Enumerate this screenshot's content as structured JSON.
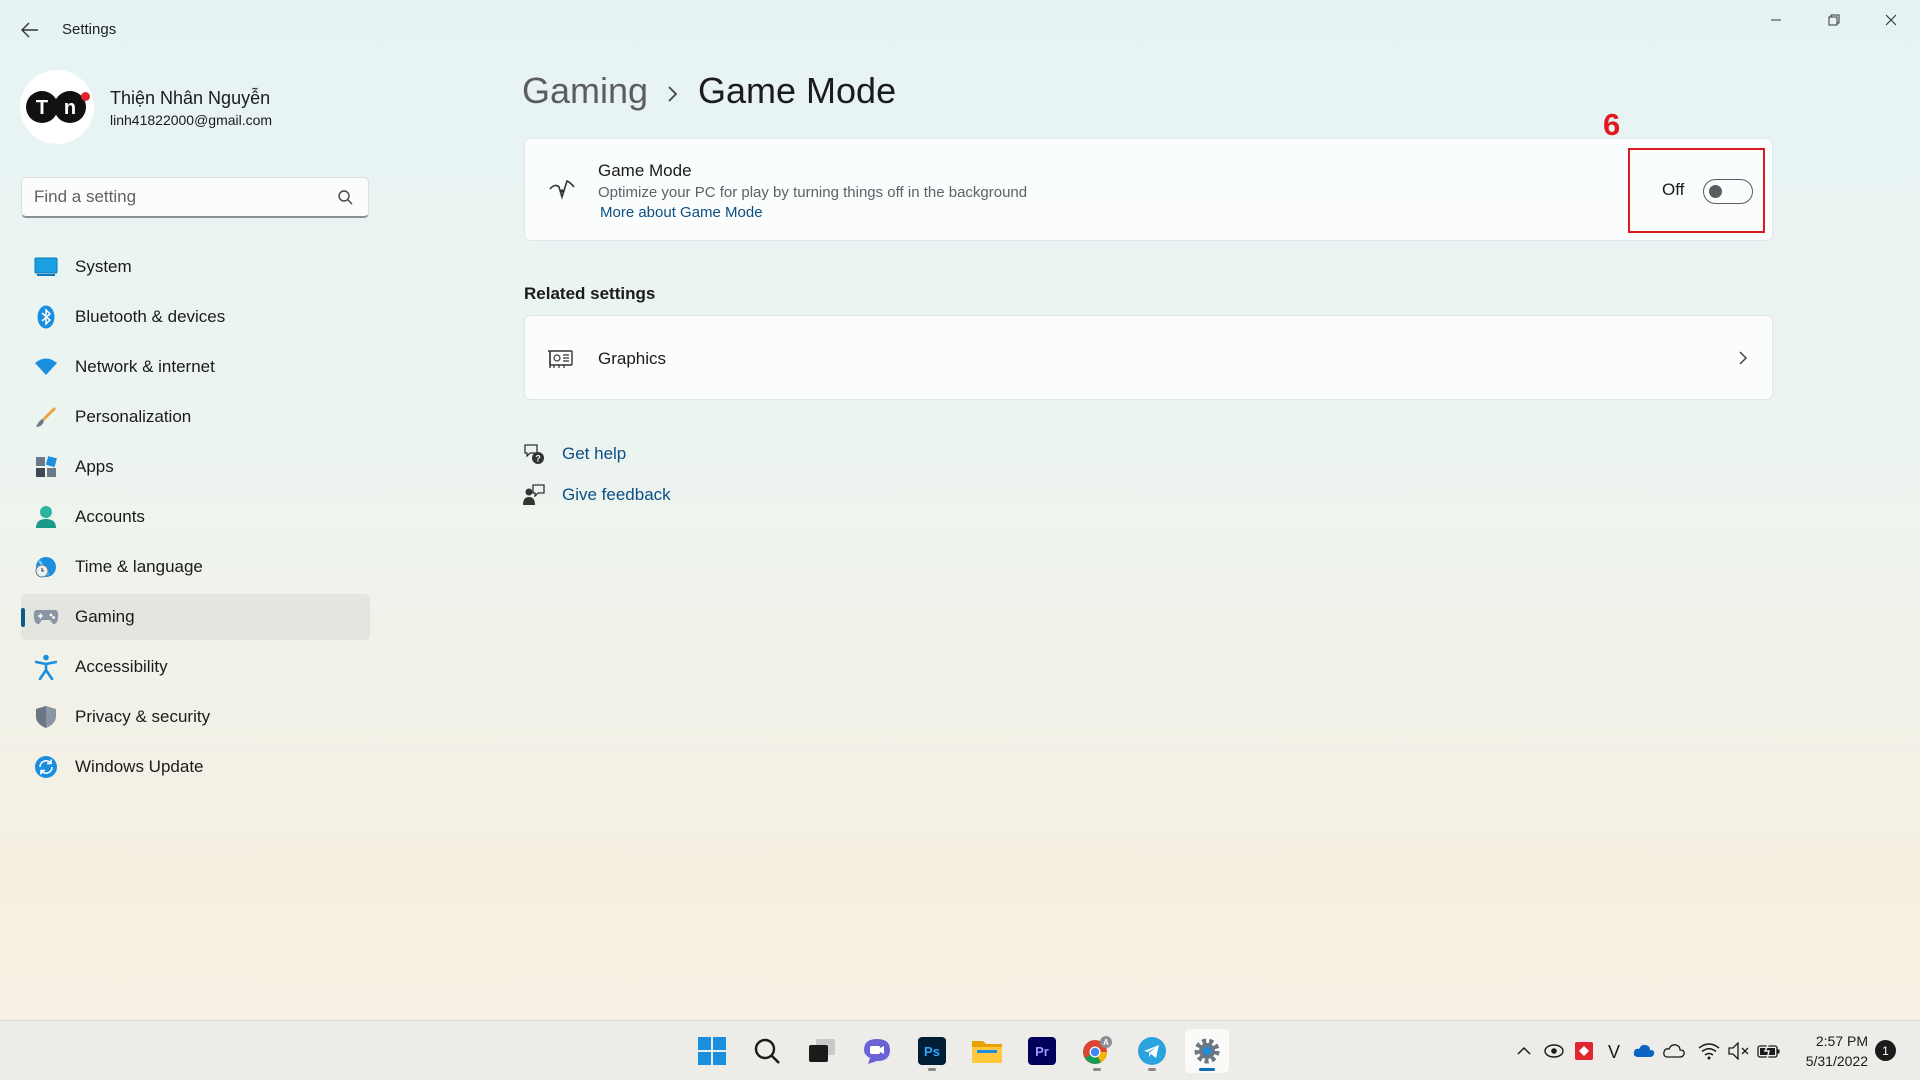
{
  "window": {
    "app_title": "Settings",
    "controls": {
      "minimize_icon": "minimize-icon",
      "maximize_icon": "restore-icon",
      "close_icon": "close-icon"
    }
  },
  "profile": {
    "avatar_text": "TN",
    "name": "Thiện Nhân Nguyễn",
    "email": "linh41822000@gmail.com"
  },
  "search": {
    "placeholder": "Find a setting",
    "icon": "search-icon"
  },
  "nav": {
    "items": [
      {
        "label": "System",
        "icon": "system-icon",
        "active": false
      },
      {
        "label": "Bluetooth & devices",
        "icon": "bluetooth-icon",
        "active": false
      },
      {
        "label": "Network & internet",
        "icon": "wifi-icon",
        "active": false
      },
      {
        "label": "Personalization",
        "icon": "brush-icon",
        "active": false
      },
      {
        "label": "Apps",
        "icon": "apps-icon",
        "active": false
      },
      {
        "label": "Accounts",
        "icon": "accounts-icon",
        "active": false
      },
      {
        "label": "Time & language",
        "icon": "time-language-icon",
        "active": false
      },
      {
        "label": "Gaming",
        "icon": "gamepad-icon",
        "active": true
      },
      {
        "label": "Accessibility",
        "icon": "accessibility-icon",
        "active": false
      },
      {
        "label": "Privacy & security",
        "icon": "shield-icon",
        "active": false
      },
      {
        "label": "Windows Update",
        "icon": "update-icon",
        "active": false
      }
    ]
  },
  "breadcrumb": {
    "parent": "Gaming",
    "current": "Game Mode"
  },
  "game_mode": {
    "title": "Game Mode",
    "description": "Optimize your PC for play by turning things off in the background",
    "link": "More about Game Mode",
    "toggle_label": "Off",
    "toggle_on": false
  },
  "annotation": {
    "step": "6",
    "color": "#e01921"
  },
  "related": {
    "heading": "Related settings",
    "items": [
      {
        "label": "Graphics",
        "icon": "graphics-icon"
      }
    ]
  },
  "help": {
    "get_help": "Get help",
    "give_feedback": "Give feedback"
  },
  "taskbar": {
    "apps": [
      "start",
      "search",
      "task-view",
      "chat",
      "photoshop",
      "file-explorer",
      "premiere",
      "chrome",
      "telegram",
      "settings"
    ],
    "ps_label": "Ps",
    "pr_label": "Pr",
    "chrome_badge": "A",
    "tray_v": "V",
    "time": "2:57 PM",
    "date": "5/31/2022",
    "notification_count": "1"
  },
  "colors": {
    "accent": "#0e5a8f",
    "link": "#0b4f86",
    "annotation_red": "#e01921"
  }
}
